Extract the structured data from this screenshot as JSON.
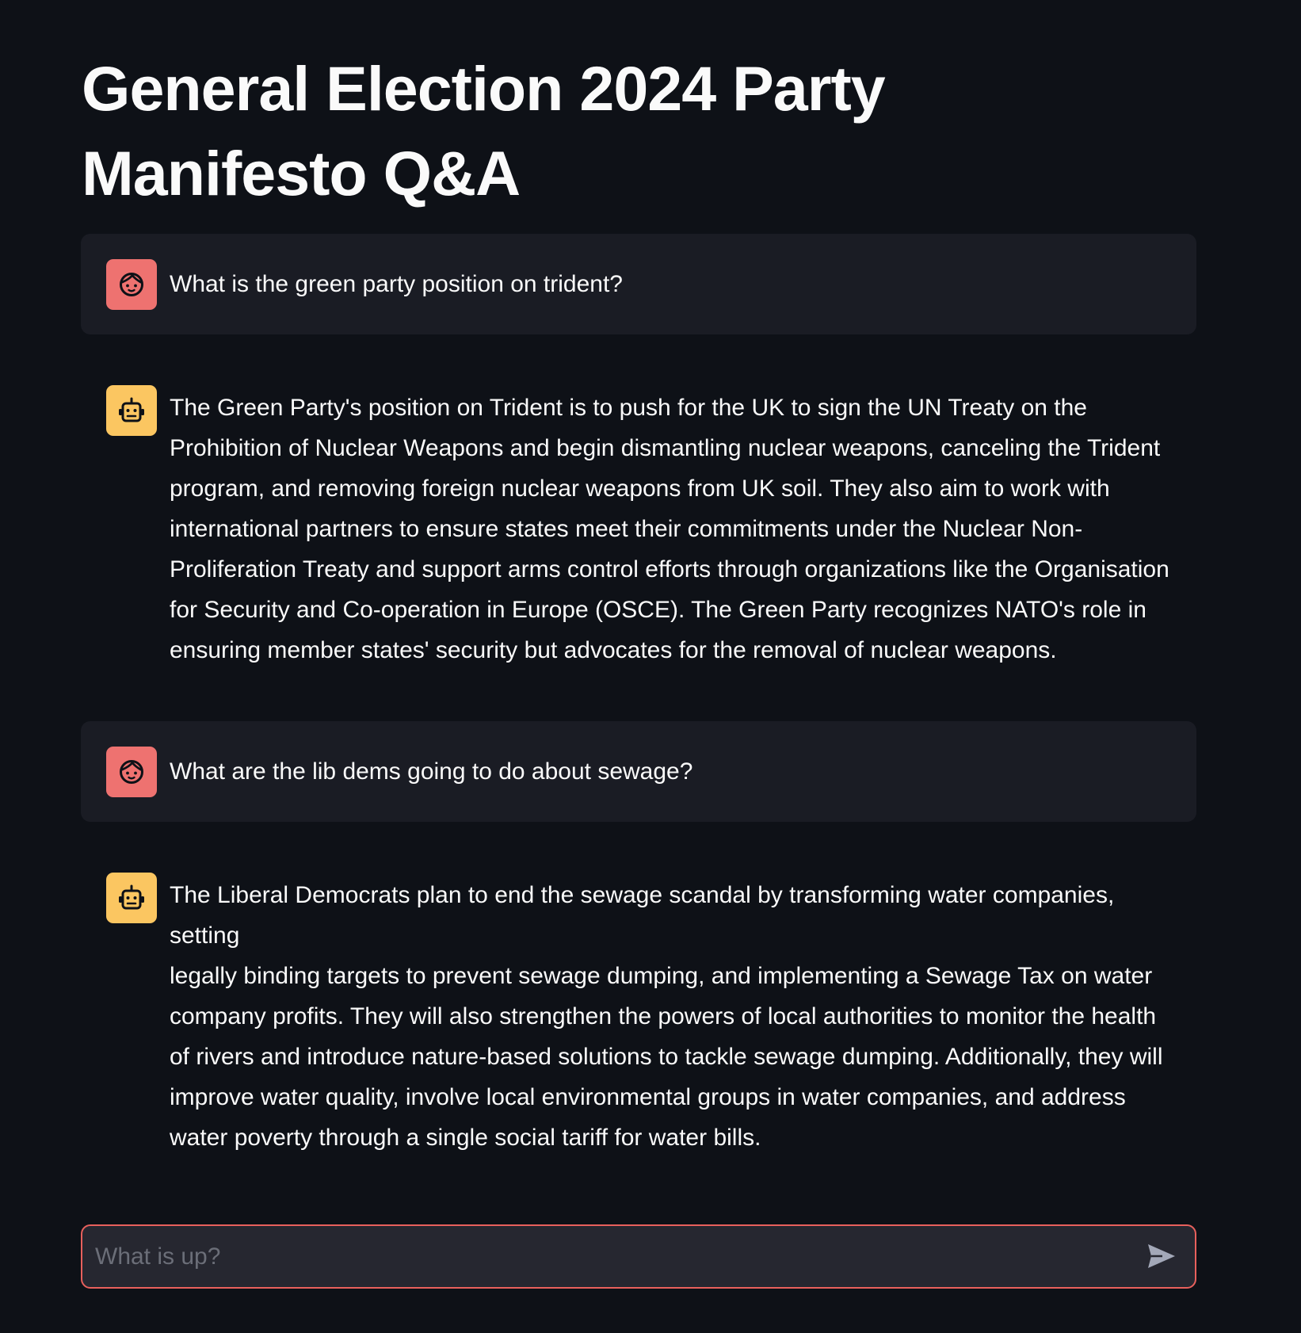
{
  "page": {
    "title": "General Election 2024 Party Manifesto Q&A"
  },
  "messages": [
    {
      "role": "user",
      "avatar_icon": "user-face-icon",
      "text": "What is the green party position on trident?"
    },
    {
      "role": "assistant",
      "avatar_icon": "robot-icon",
      "text": "The Green Party's position on Trident is to push for the UK to sign the UN Treaty on the\nProhibition of Nuclear Weapons and begin dismantling nuclear weapons, canceling the Trident\nprogram, and removing foreign nuclear weapons from UK soil. They also aim to work with\ninternational partners to ensure states meet their commitments under the Nuclear Non-\nProliferation Treaty and support arms control efforts through organizations like the Organisation\nfor Security and Co-operation in Europe (OSCE). The Green Party recognizes NATO's role in\nensuring member states' security but advocates for the removal of nuclear weapons."
    },
    {
      "role": "user",
      "avatar_icon": "user-face-icon",
      "text": "What are the lib dems going to do about sewage?"
    },
    {
      "role": "assistant",
      "avatar_icon": "robot-icon",
      "text": "The Liberal Democrats plan to end the sewage scandal by transforming water companies, setting\nlegally binding targets to prevent sewage dumping, and implementing a Sewage Tax on water\ncompany profits. They will also strengthen the powers of local authorities to monitor the health\nof rivers and introduce nature-based solutions to tackle sewage dumping. Additionally, they will\nimprove water quality, involve local environmental groups in water companies, and address\nwater poverty through a single social tariff for water bills."
    }
  ],
  "chat_input": {
    "placeholder": "What is up?",
    "value": "",
    "send_icon": "send-icon"
  },
  "colors": {
    "background": "#0e1117",
    "user_message_bg": "#1a1c24",
    "user_avatar": "#ee7270",
    "assistant_avatar": "#fbc661",
    "input_border": "#e8605c",
    "input_bg": "#262730"
  }
}
